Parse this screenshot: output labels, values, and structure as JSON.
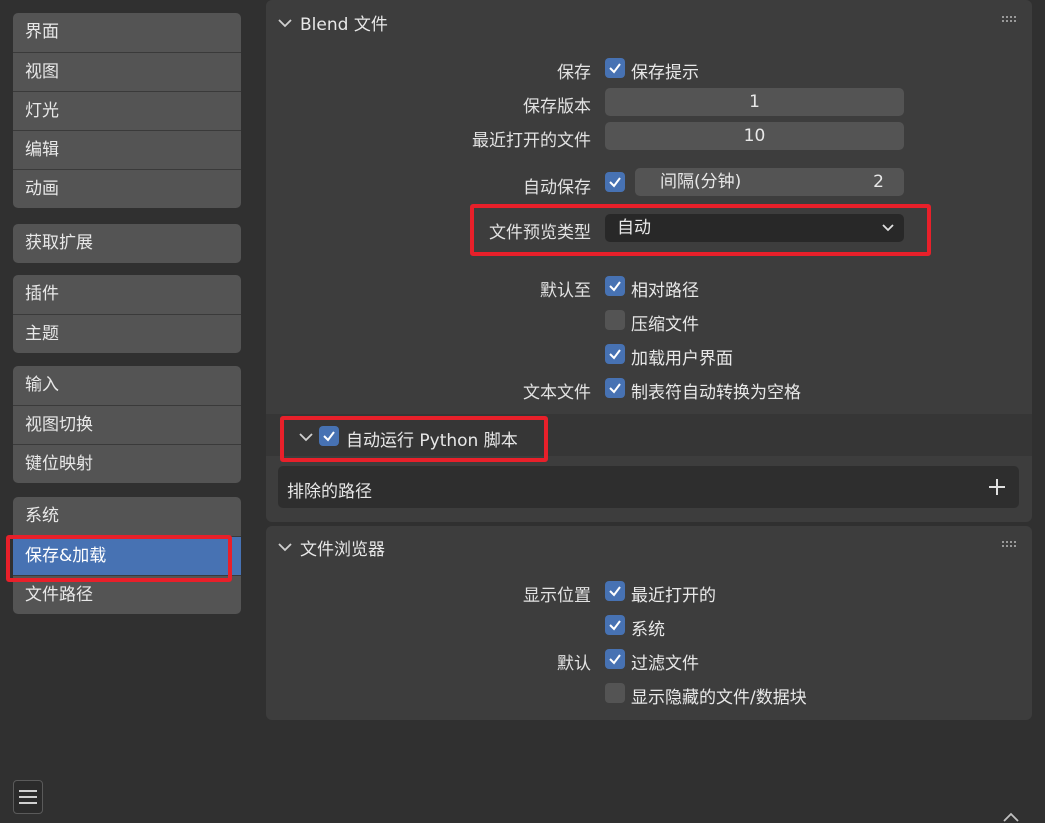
{
  "sidebar": {
    "groups": [
      [
        "界面",
        "视图",
        "灯光",
        "编辑",
        "动画"
      ],
      [
        "获取扩展"
      ],
      [
        "插件",
        "主题"
      ],
      [
        "输入",
        "视图切换",
        "键位映射"
      ],
      [
        "系统",
        "保存&加载",
        "文件路径"
      ]
    ],
    "active": "保存&加载"
  },
  "blend": {
    "title": "Blend 文件",
    "save_label": "保存",
    "save_prompt": "保存提示",
    "save_versions_label": "保存版本",
    "save_versions": "1",
    "recent_files_label": "最近打开的文件",
    "recent_files": "10",
    "autosave_label": "自动保存",
    "interval_label": "间隔(分钟)",
    "interval_value": "2",
    "preview_type_label": "文件预览类型",
    "preview_type": "自动",
    "default_to_label": "默认至",
    "relative_paths": "相对路径",
    "compress_file": "压缩文件",
    "load_ui": "加载用户界面",
    "text_files_label": "文本文件",
    "tabs_to_spaces": "制表符自动转换为空格",
    "autorun_label": "自动运行 Python 脚本",
    "excluded_paths_label": "排除的路径"
  },
  "file_browser": {
    "title": "文件浏览器",
    "show_locations_label": "显示位置",
    "recent": "最近打开的",
    "system": "系统",
    "defaults_label": "默认",
    "filter_files": "过滤文件",
    "show_hidden": "显示隐藏的文件/数据块"
  },
  "colors": {
    "accent": "#4772b3",
    "highlight": "#e8202a"
  }
}
